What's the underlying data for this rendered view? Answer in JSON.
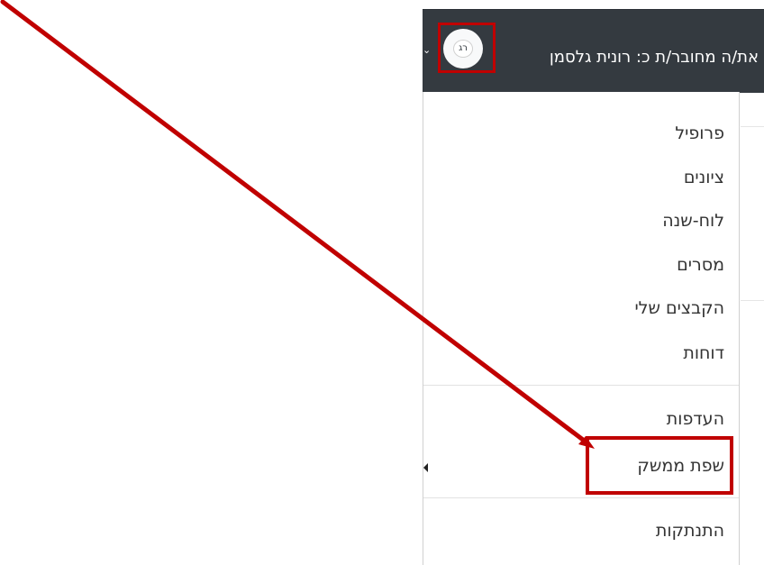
{
  "header": {
    "logged_in_text": "את/ה מחובר/ת כ: רונית גלסמן",
    "avatar_initials": "רג",
    "dropdown_caret": "⌄"
  },
  "user_menu": {
    "items": [
      {
        "label": "פרופיל"
      },
      {
        "label": "ציונים"
      },
      {
        "label": "לוח-שנה"
      },
      {
        "label": "מסרים"
      },
      {
        "label": "הקבצים שלי"
      },
      {
        "label": "דוחות"
      },
      {
        "label": "העדפות"
      },
      {
        "label": "שפת ממשק"
      },
      {
        "label": "התנתקות"
      }
    ]
  },
  "annotation": {
    "highlight_color": "#c00000",
    "arrow_color": "#c00000"
  },
  "colors": {
    "topbar_bg": "#343a40",
    "menu_bg": "#ffffff",
    "text": "#333333"
  }
}
